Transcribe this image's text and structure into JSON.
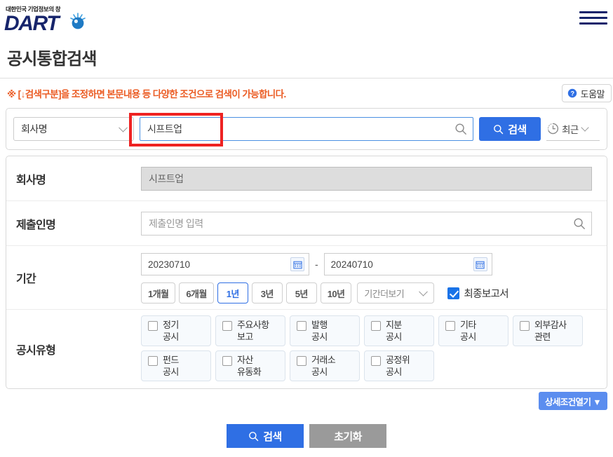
{
  "header": {
    "logo_tagline": "대한민국 기업정보의 창",
    "logo_text": "DART",
    "menu_icon": "hamburger-menu-icon"
  },
  "page_title": "공시통합검색",
  "notice": {
    "text": "※ [↓검색구분]을 조정하면 본문내용 등 다양한 조건으로 검색이 가능합니다.",
    "help_label": "도움말",
    "help_icon": "help-pin-icon"
  },
  "search_bar": {
    "kind_selected": "회사명",
    "keyword_value": "시프트업",
    "keyword_icon": "search-icon",
    "search_button": "검색",
    "search_button_icon": "search-icon",
    "recent_label": "최근",
    "recent_icon": "clock-history-icon",
    "accent_color": "#2f6fe4",
    "highlight_color": "#ee2222"
  },
  "form": {
    "company": {
      "label": "회사명",
      "value": "시프트업"
    },
    "filer": {
      "label": "제출인명",
      "placeholder": "제출인명 입력",
      "value": "",
      "icon": "search-icon"
    },
    "period": {
      "label": "기간",
      "date_from": "20230710",
      "date_to": "20240710",
      "separator": "-",
      "calendar_icon": "calendar-icon",
      "presets": [
        {
          "label": "1개월",
          "active": false
        },
        {
          "label": "6개월",
          "active": false
        },
        {
          "label": "1년",
          "active": true
        },
        {
          "label": "3년",
          "active": false
        },
        {
          "label": "5년",
          "active": false
        },
        {
          "label": "10년",
          "active": false
        }
      ],
      "more_select": "기간더보기",
      "final_report": {
        "label": "최종보고서",
        "checked": true
      }
    },
    "disclosure_type": {
      "label": "공시유형",
      "rows": [
        [
          {
            "line1": "정기",
            "line2": "공시",
            "checked": false
          },
          {
            "line1": "주요사항",
            "line2": "보고",
            "checked": false
          },
          {
            "line1": "발행",
            "line2": "공시",
            "checked": false
          },
          {
            "line1": "지분",
            "line2": "공시",
            "checked": false
          },
          {
            "line1": "기타",
            "line2": "공시",
            "checked": false
          },
          {
            "line1": "외부감사",
            "line2": "관련",
            "checked": false
          }
        ],
        [
          {
            "line1": "펀드",
            "line2": "공시",
            "checked": false
          },
          {
            "line1": "자산",
            "line2": "유동화",
            "checked": false
          },
          {
            "line1": "거래소",
            "line2": "공시",
            "checked": false
          },
          {
            "line1": "공정위",
            "line2": "공시",
            "checked": false
          }
        ]
      ]
    }
  },
  "footer": {
    "detail_toggle": "상세조건열기 ▼",
    "submit_label": "검색",
    "submit_icon": "search-icon",
    "reset_label": "초기화"
  }
}
